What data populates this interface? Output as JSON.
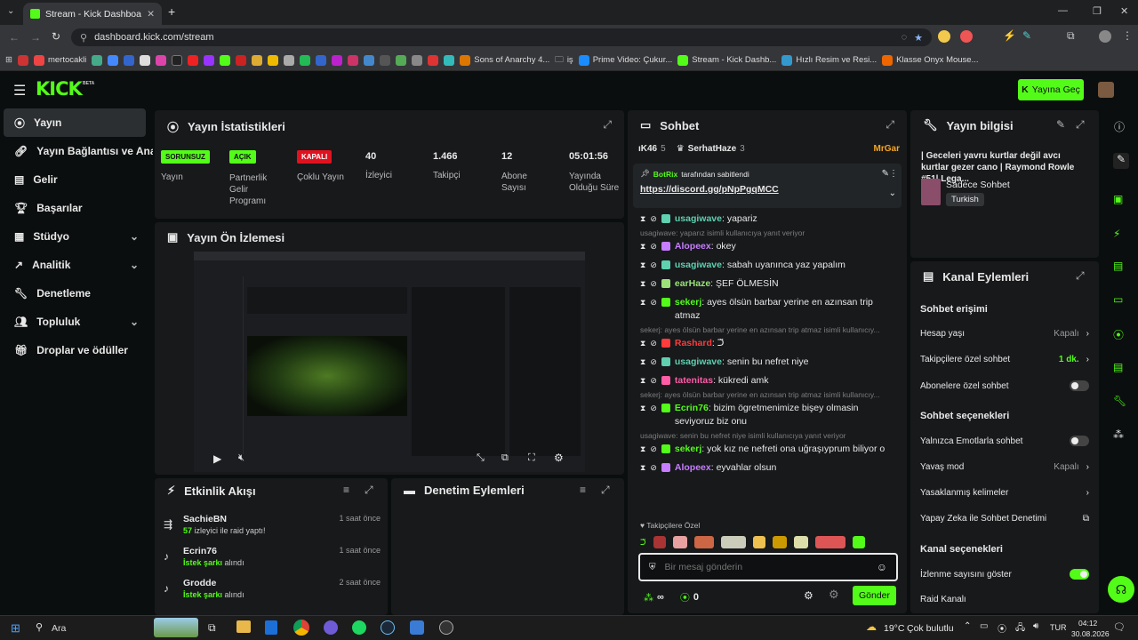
{
  "browser": {
    "tab_title": "Stream - Kick Dashboard",
    "url": "dashboard.kick.com/stream",
    "bookmarks": [
      "mertocakli",
      "Sons of Anarchy 4...",
      "iş",
      "Prime Video: Çukur...",
      "Stream - Kick Dashb...",
      "Hızlı Resim ve Resi...",
      "Klasse Onyx Mouse..."
    ]
  },
  "header": {
    "go_live": "Yayına Geç",
    "logo": "KICK",
    "beta": "BETA"
  },
  "sidebar": {
    "items": [
      {
        "label": "Yayın"
      },
      {
        "label": "Yayın Bağlantısı ve Anahtarı"
      },
      {
        "label": "Gelir"
      },
      {
        "label": "Başarılar"
      },
      {
        "label": "Stüdyo"
      },
      {
        "label": "Analitik"
      },
      {
        "label": "Denetleme"
      },
      {
        "label": "Topluluk"
      },
      {
        "label": "Droplar ve ödüller"
      }
    ]
  },
  "stats": {
    "title": "Yayın İstatistikleri",
    "items": [
      {
        "badge": "SORUNSUZ",
        "label": "Yayın"
      },
      {
        "badge": "AÇIK",
        "label": "Partnerlik Gelir Programı"
      },
      {
        "badge": "KAPALI",
        "label": "Çoklu Yayın"
      },
      {
        "value": "40",
        "label": "İzleyici"
      },
      {
        "value": "1.466",
        "label": "Takipçi"
      },
      {
        "value": "12",
        "label": "Abone Sayısı"
      },
      {
        "value": "05:01:56",
        "label": "Yayında Olduğu Süre"
      }
    ]
  },
  "preview": {
    "title": "Yayın Ön İzlemesi"
  },
  "activity": {
    "title": "Etkinlik Akışı",
    "items": [
      {
        "user": "SachieBN",
        "time": "1 saat önce",
        "hl": "57",
        "detail": " izleyici ile raid yaptı!"
      },
      {
        "user": "Ecrin76",
        "time": "1 saat önce",
        "hl": "İstek şarkı",
        "detail": " alındı"
      },
      {
        "user": "Grodde",
        "time": "2 saat önce",
        "hl": "İstek şarkı",
        "detail": " alındı"
      }
    ]
  },
  "moderation": {
    "title": "Denetim Eylemleri"
  },
  "chat": {
    "title": "Sohbet",
    "top": {
      "a_count": "5",
      "a_name": "ıK46",
      "b_name": "SerhatHaze",
      "b_count": "3",
      "c_name": "MrGar"
    },
    "pinned": {
      "by_name": "BotRix",
      "by_suffix": " tarafından sabitlendi",
      "link": "https://discord.gg/pNpPgqMCC"
    },
    "messages": [
      {
        "user": "usagiwave",
        "color": "#5fd0b0",
        "text": "yapariz"
      },
      {
        "reply": "usagiwave: yaparız isimli kullanıcıya yanıt veriyor"
      },
      {
        "user": "Alopeex",
        "color": "#c77dff",
        "text": "okey"
      },
      {
        "user": "usagiwave",
        "color": "#5fd0b0",
        "text": "sabah uyanınca yaz yapalım"
      },
      {
        "user": "earHaze",
        "color": "#9be37a",
        "text": "ŞEF ÖLMESİN"
      },
      {
        "user": "sekerj",
        "color": "#53fc18",
        "text": "ayes ölsün barbar yerine en azınsan trip atmaz"
      },
      {
        "reply": "sekerj: ayes ölsün barbar yerine en azınsan trip atmaz isimli kullanıcıy..."
      },
      {
        "user": "Rashard",
        "color": "#ff3b3b",
        "text": "ᑐ̈"
      },
      {
        "user": "usagiwave",
        "color": "#5fd0b0",
        "text": "senin bu nefret niye"
      },
      {
        "user": "tatenitas",
        "color": "#ff5ca8",
        "text": "kükredi amk"
      },
      {
        "reply": "sekerj: ayes ölsün barbar yerine en azınsan trip atmaz isimli kullanıcıy..."
      },
      {
        "user": "Ecrin76",
        "color": "#53fc18",
        "text": "bizim ögretmenimize bişey olmasin seviyoruz biz onu"
      },
      {
        "reply": "usagiwave: senin bu nefret niye isimli kullanıcıya yanıt veriyor"
      },
      {
        "user": "sekerj",
        "color": "#53fc18",
        "text": "yok kız ne nefreti ona uğraşıyprum biliyor o"
      },
      {
        "user": "Alopeex",
        "color": "#c77dff",
        "text": "eyvahlar olsun"
      }
    ],
    "emote_label": "Takipçilere Özel",
    "input_placeholder": "Bir mesaj gönderin",
    "infinity": "∞",
    "points": "0",
    "send": "Gönder"
  },
  "stream_info": {
    "title": "Yayın bilgisi",
    "stream_title": "| Geceleri yavru kurtlar değil avcı kurtlar gezer cano | Raymond Rowle #51| Lega...",
    "category": "Sadece Sohbet",
    "language": "Turkish"
  },
  "channel_actions": {
    "title": "Kanal Eylemleri",
    "chat_access": "Sohbet erişimi",
    "account_age": {
      "label": "Hesap yaşı",
      "value": "Kapalı"
    },
    "followers_only": {
      "label": "Takipçilere özel sohbet",
      "value": "1 dk."
    },
    "subs_only": {
      "label": "Abonelere özel sohbet"
    },
    "chat_options": "Sohbet seçenekleri",
    "emote_only": {
      "label": "Yalnızca Emotlarla sohbet"
    },
    "slow_mode": {
      "label": "Yavaş mod",
      "value": "Kapalı"
    },
    "banned_words": {
      "label": "Yasaklanmış kelimeler"
    },
    "ai_moderation": {
      "label": "Yapay Zeka ile Sohbet Denetimi"
    },
    "channel_options": "Kanal seçenekleri",
    "show_viewers": {
      "label": "İzlenme sayısını göster"
    },
    "raid_channel": {
      "label": "Raid Kanalı"
    }
  },
  "taskbar": {
    "search": "Ara",
    "weather": "19°C",
    "weather_text": "Çok bulutlu",
    "lang": "TUR",
    "time": "04:12",
    "date": "30.08.2026"
  },
  "colors": {
    "accent": "#53fc18",
    "panel": "#17191b",
    "bg": "#0b0e0f"
  }
}
